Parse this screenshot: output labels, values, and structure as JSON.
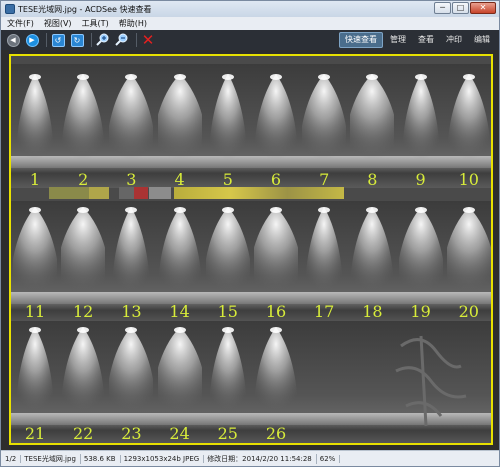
{
  "window": {
    "title": "TESE光域网.jpg - ACDSee 快速查看",
    "buttons": [
      "─",
      "□",
      "✕"
    ]
  },
  "menu": [
    "文件(F)",
    "视图(V)",
    "工具(T)",
    "帮助(H)"
  ],
  "toolbar": {
    "icons": [
      "back-icon",
      "forward-icon",
      "rotate-left-icon",
      "rotate-right-icon",
      "zoom-in-icon",
      "zoom-out-icon",
      "delete-icon"
    ],
    "modes": [
      "快速查看",
      "管理",
      "查看",
      "冲印",
      "编辑"
    ],
    "active_mode": "快速查看"
  },
  "image": {
    "labels": [
      "1",
      "2",
      "3",
      "4",
      "5",
      "6",
      "7",
      "8",
      "9",
      "10",
      "11",
      "12",
      "13",
      "14",
      "15",
      "16",
      "17",
      "18",
      "19",
      "20",
      "21",
      "22",
      "23",
      "24",
      "25",
      "26"
    ],
    "frame_color": "#e8e100",
    "label_color": "#d8ec3a"
  },
  "status": {
    "index": "1/2",
    "filename": "TESE光域网.jpg",
    "size": "538.6 KB",
    "dims": "1293x1053x24b JPEG",
    "modified": "修改日期：2014/2/20 11:54:28",
    "zoom": "62%"
  }
}
